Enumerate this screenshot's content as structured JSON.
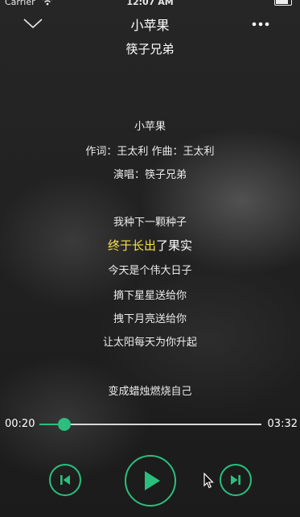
{
  "status_bar": {
    "carrier": "Carrier",
    "time": "12:07 AM"
  },
  "header": {
    "title": "小苹果",
    "artist": "筷子兄弟",
    "collapse_icon": "chevron-down-icon",
    "more_icon": "more-dots-icon"
  },
  "lyrics": {
    "lines": [
      "小苹果",
      "作词：王太利 作曲：王太利",
      "演唱：筷子兄弟",
      "我种下一颗种子",
      "今天是个伟大日子",
      "摘下星星送给你",
      "拽下月亮送给你",
      "让太阳每天为你升起",
      "变成蜡烛燃烧自己"
    ],
    "current": {
      "sung": "终于长出",
      "unsung": "了果实"
    }
  },
  "progress": {
    "elapsed": "00:20",
    "total": "03:32",
    "fraction": 0.113
  },
  "controls": {
    "prev_icon": "previous-track-icon",
    "play_icon": "play-icon",
    "next_icon": "next-track-icon"
  },
  "colors": {
    "accent": "#2bbf7d",
    "highlight": "#f2e14a",
    "background": "#1f1f1f"
  }
}
